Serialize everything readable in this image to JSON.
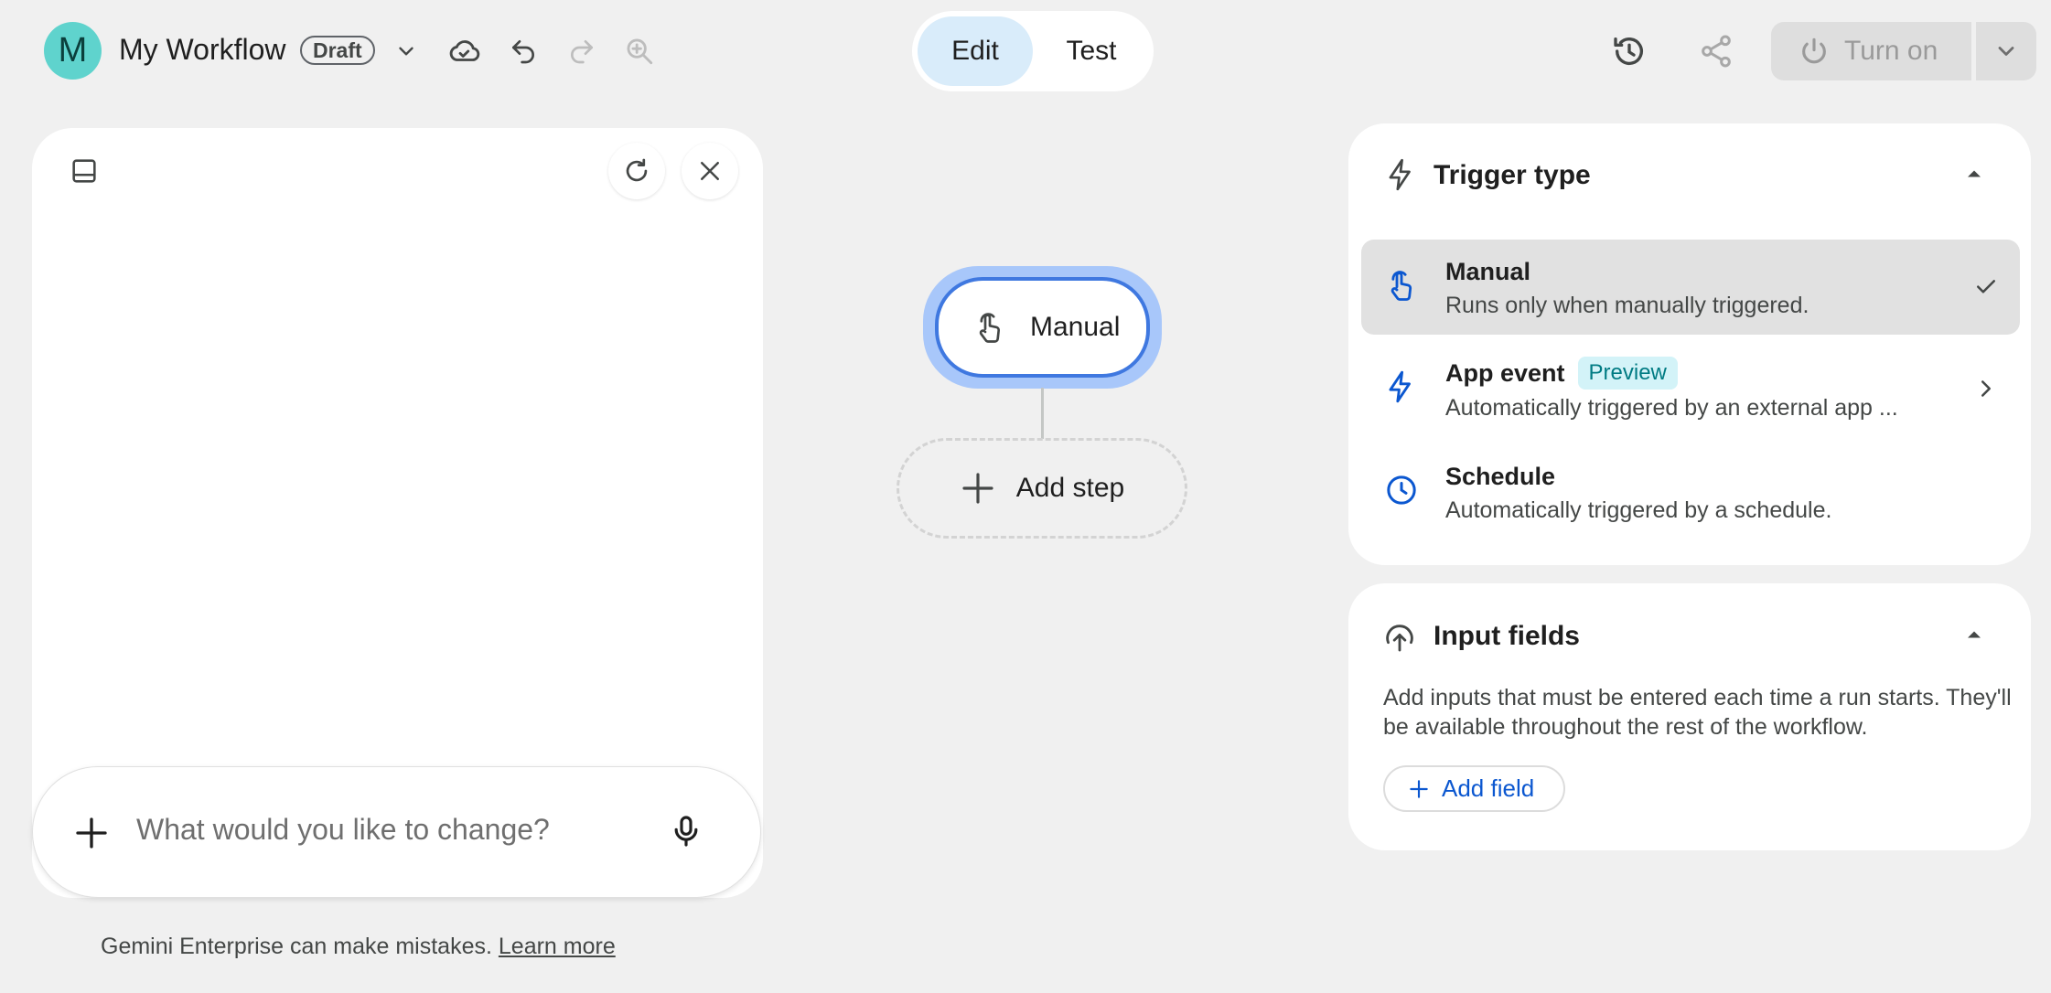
{
  "header": {
    "avatar_letter": "M",
    "workflow_title": "My Workflow",
    "draft_label": "Draft",
    "icons": [
      "chevron-down-icon",
      "cloud-check-icon",
      "undo-icon",
      "redo-icon",
      "zoom-in-icon"
    ]
  },
  "mode_toggle": {
    "edit_label": "Edit",
    "test_label": "Test",
    "active": "Edit"
  },
  "actions": {
    "icons": [
      "history-icon",
      "share-icon"
    ],
    "turn_on_label": "Turn on"
  },
  "chat": {
    "icons": [
      "panel-toggle-icon",
      "refresh-icon",
      "close-icon"
    ],
    "input_placeholder": "What would you like to change?",
    "disclaimer_text": "Gemini Enterprise can make mistakes.",
    "learn_more_label": "Learn more"
  },
  "canvas": {
    "trigger_node_label": "Manual",
    "add_step_label": "Add step"
  },
  "trigger_panel": {
    "title": "Trigger type",
    "options": [
      {
        "title": "Manual",
        "description": "Runs only when manually triggered.",
        "icon": "touch-icon",
        "selected": true
      },
      {
        "title": "App event",
        "badge": "Preview",
        "description": "Automatically triggered by an external app ...",
        "icon": "bolt-icon",
        "selected": false
      },
      {
        "title": "Schedule",
        "description": "Automatically triggered by a schedule.",
        "icon": "clock-icon",
        "selected": false
      }
    ]
  },
  "input_panel": {
    "title": "Input fields",
    "description": "Add inputs that must be entered each time a run starts. They'll be available throughout the rest of the workflow.",
    "add_field_label": "Add field"
  },
  "colors": {
    "background": "#f0f0f0",
    "accent_blue": "#0b57d0",
    "node_border": "#3f78e0",
    "avatar": "#5fd3cd",
    "edit_active": "#d9ecfa",
    "preview_badge_bg": "#d3f3f8",
    "preview_badge_text": "#007b83"
  }
}
